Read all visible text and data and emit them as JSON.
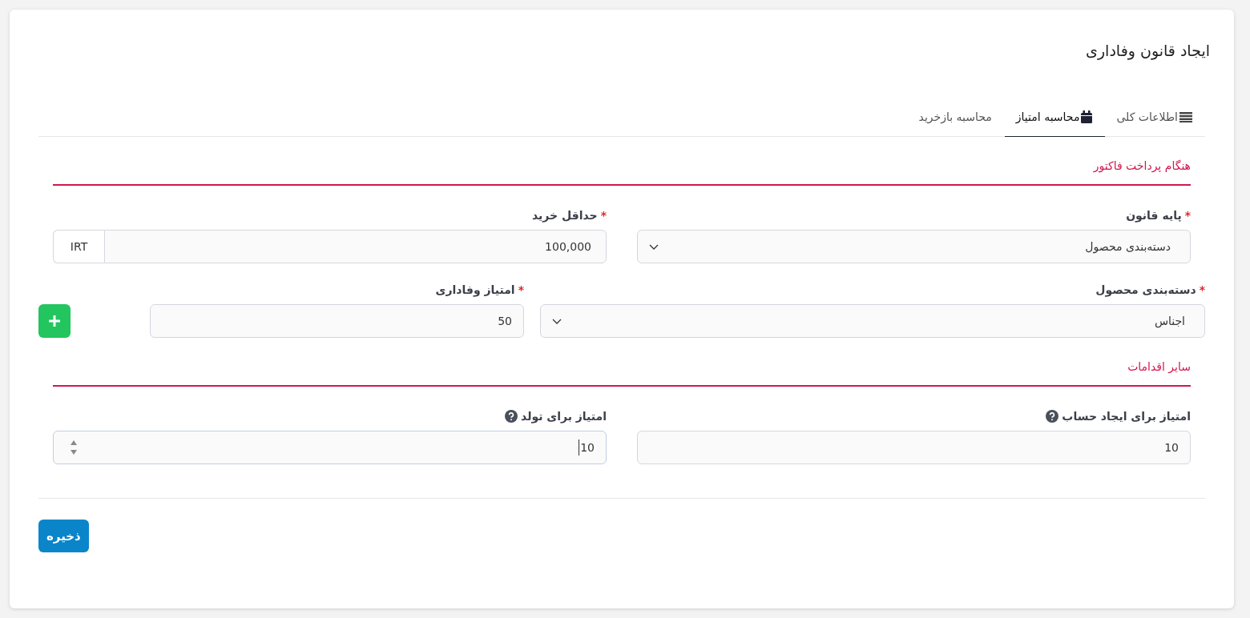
{
  "title": "ایجاد قانون وفاداری",
  "tabs": [
    {
      "label": "اطلاعات کلی",
      "kind": "list",
      "selected": false
    },
    {
      "label": "محاسبه امتیاز",
      "kind": "calendar",
      "selected": true
    },
    {
      "label": "محاسبه بازخرید",
      "kind": "plain",
      "selected": false
    }
  ],
  "sections": [
    {
      "heading": "هنگام پرداخت فاکتور",
      "rows": [
        {
          "kind": "pair",
          "fields": [
            {
              "kind": "select",
              "label": "پایه قانون",
              "required_mark": "*",
              "value": "دسته‌بندی محصول"
            },
            {
              "kind": "addon",
              "label": "حداقل خرید",
              "required_mark": "*",
              "value": "100,000",
              "addon": "IRT"
            }
          ]
        },
        {
          "kind": "repeat",
          "fields": [
            {
              "kind": "select",
              "label": "دسته‌بندی محصول",
              "required_mark": "*",
              "value": "اجناس"
            },
            {
              "kind": "text",
              "label": "امتیاز وفاداری",
              "required_mark": "*",
              "value": "50"
            },
            {
              "kind": "add"
            }
          ]
        }
      ]
    },
    {
      "heading": "سایر اقدامات",
      "rows": [
        {
          "kind": "pair",
          "fields": [
            {
              "kind": "text",
              "label": "امتیاز برای ایجاد حساب",
              "help": true,
              "value": "10"
            },
            {
              "kind": "number",
              "label": "امتیاز برای تولد",
              "help": true,
              "value": "10",
              "focused": true
            }
          ]
        }
      ]
    }
  ],
  "save": "ذخیره"
}
